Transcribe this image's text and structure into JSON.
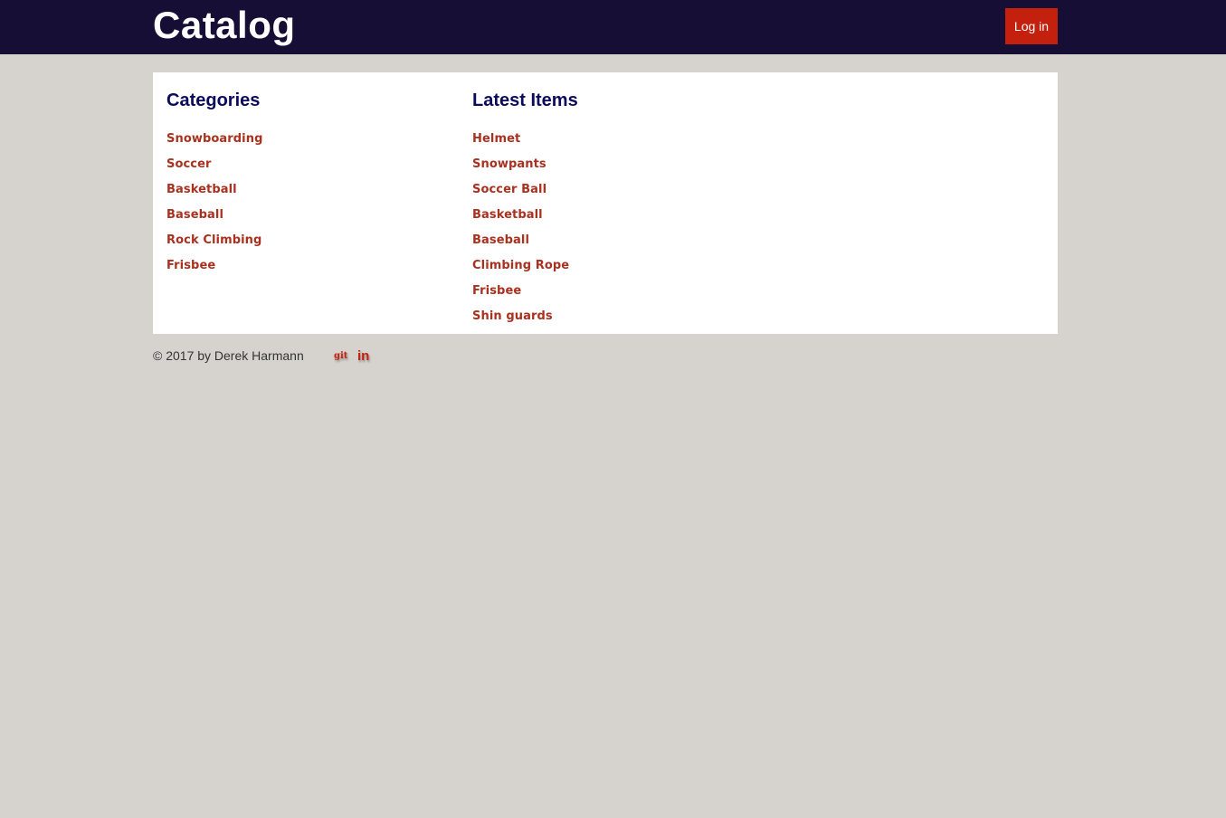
{
  "header": {
    "brand": "Catalog",
    "login_label": "Log in"
  },
  "categories": {
    "heading": "Categories",
    "items": [
      "Snowboarding",
      "Soccer",
      "Basketball",
      "Baseball",
      "Rock Climbing",
      "Frisbee"
    ]
  },
  "latest": {
    "heading": "Latest Items",
    "items": [
      "Helmet",
      "Snowpants",
      "Soccer Ball",
      "Basketball",
      "Baseball",
      "Climbing Rope",
      "Frisbee",
      "Shin guards"
    ]
  },
  "footer": {
    "copyright": "© 2017 by Derek Harmann",
    "git_label": "git",
    "linkedin_label": "in"
  },
  "colors": {
    "header_bg": "#160e34",
    "accent": "#c4200e",
    "heading": "#0c0a5c",
    "link": "#a8311f",
    "page_bg": "#d6d3ce"
  },
  "icons": {
    "git": "git-icon",
    "linkedin": "linkedin-icon"
  }
}
